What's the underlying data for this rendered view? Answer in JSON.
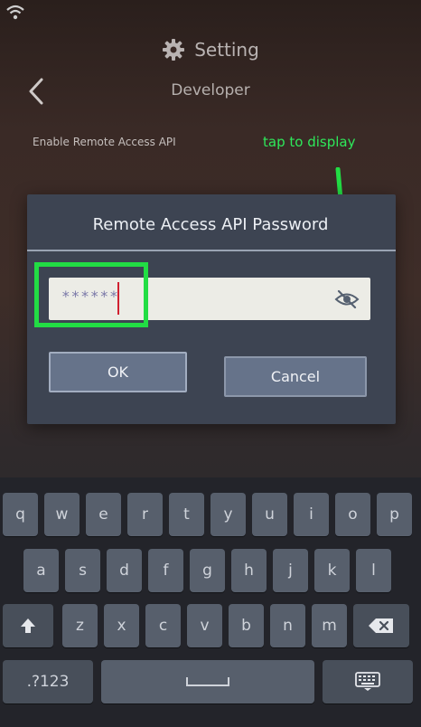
{
  "status_bar": {
    "wifi_icon": "wifi-icon"
  },
  "header": {
    "title": "Setting",
    "icon": "gear-icon"
  },
  "nav": {
    "back_icon": "chevron-left-icon",
    "title": "Developer"
  },
  "settings": {
    "remote_access_label": "Enable Remote Access API"
  },
  "annotation": {
    "text": "tap to display",
    "color": "#2ee85a"
  },
  "dialog": {
    "title": "Remote Access API Password",
    "password_value": "******",
    "eye_icon": "eye-slash-icon",
    "ok_label": "OK",
    "cancel_label": "Cancel"
  },
  "keyboard": {
    "row1": [
      "q",
      "w",
      "e",
      "r",
      "t",
      "y",
      "u",
      "i",
      "o",
      "p"
    ],
    "row2": [
      "a",
      "s",
      "d",
      "f",
      "g",
      "h",
      "j",
      "k",
      "l"
    ],
    "row3": [
      "z",
      "x",
      "c",
      "v",
      "b",
      "n",
      "m"
    ],
    "symbols_label": ".?123",
    "shift_icon": "shift-icon",
    "backspace_icon": "backspace-icon",
    "space_icon": "space-bar-icon",
    "hide_keyboard_icon": "keyboard-icon"
  }
}
